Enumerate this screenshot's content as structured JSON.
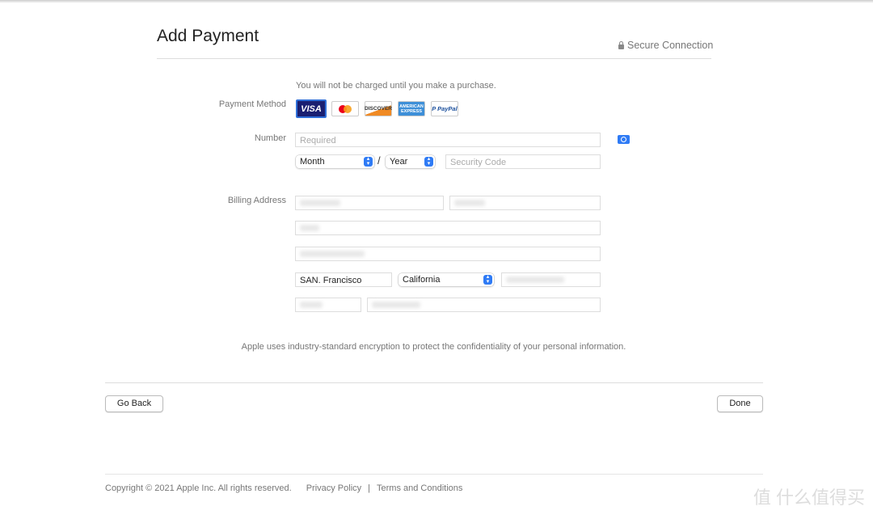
{
  "header": {
    "title": "Add Payment",
    "secure": "Secure Connection"
  },
  "notice": "You will not be charged until you make a purchase.",
  "payment_method": {
    "label": "Payment Method",
    "cards": [
      "VISA",
      "mastercard",
      "DISCOVER",
      "AMERICAN EXPRESS",
      "PayPal"
    ],
    "selected": "VISA"
  },
  "number": {
    "label": "Number",
    "placeholder": "Required",
    "month": "Month",
    "separator": "/",
    "year": "Year",
    "security_placeholder": "Security Code"
  },
  "billing": {
    "label": "Billing Address",
    "city": "SAN. Francisco",
    "state": "California"
  },
  "encryption_note": "Apple uses industry-standard encryption to protect the confidentiality of your personal information.",
  "buttons": {
    "back": "Go Back",
    "done": "Done"
  },
  "footer": {
    "copyright": "Copyright © 2021 Apple Inc. All rights reserved.",
    "privacy": "Privacy Policy",
    "sep": "|",
    "terms": "Terms and Conditions"
  },
  "watermark": "值 什么值得买",
  "colors": {
    "accent": "#2f7bf5",
    "visa": "#1a1f71"
  }
}
